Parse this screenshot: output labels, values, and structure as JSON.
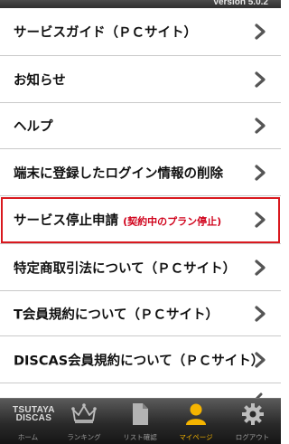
{
  "header": {
    "version": "Version 5.0.2"
  },
  "menu": {
    "items": [
      {
        "label": "サービスガイド（ＰＣサイト）"
      },
      {
        "label": "お知らせ"
      },
      {
        "label": "ヘルプ"
      },
      {
        "label": "端末に登録したログイン情報の削除"
      },
      {
        "label": "サービス停止申請",
        "note": "(契約中のプラン停止)"
      },
      {
        "label": "特定商取引法について（ＰＣサイト）"
      },
      {
        "label": "T会員規約について（ＰＣサイト）"
      },
      {
        "label": "DISCAS会員規約について（ＰＣサイト）"
      }
    ]
  },
  "tabbar": {
    "logo_top": "TSUTAYA",
    "logo_bottom": "DISCAS",
    "tabs": [
      {
        "label": "ホーム",
        "icon": "home-logo-icon"
      },
      {
        "label": "ランキング",
        "icon": "crown-icon"
      },
      {
        "label": "リスト確認",
        "icon": "document-icon"
      },
      {
        "label": "マイページ",
        "icon": "person-icon",
        "active": true
      },
      {
        "label": "ログアウト",
        "icon": "gear-icon"
      }
    ],
    "active_color": "#f5b400"
  },
  "colors": {
    "highlight_border": "#d9181e",
    "note_text": "#d0021b"
  }
}
